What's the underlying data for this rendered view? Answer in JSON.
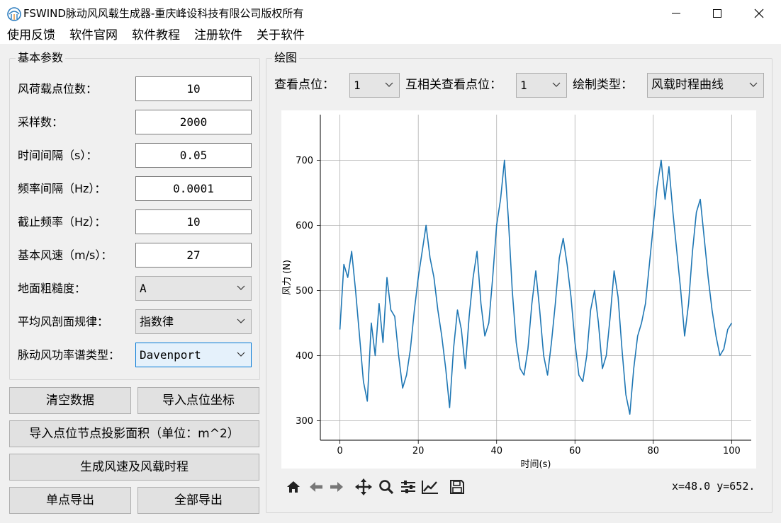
{
  "window": {
    "title": "FSWIND脉动风风载生成器-重庆峰设科技有限公司版权所有",
    "minimize_glyph": "—",
    "maximize_glyph": "☐",
    "close_glyph": "✕"
  },
  "menu": {
    "items": [
      "使用反馈",
      "软件官网",
      "软件教程",
      "注册软件",
      "关于软件"
    ]
  },
  "params": {
    "group_title": "基本参数",
    "fields": [
      {
        "label": "风荷载点位数：",
        "value": "10"
      },
      {
        "label": "采样数：",
        "value": "2000"
      },
      {
        "label": "时间间隔（s）：",
        "value": "0.05"
      },
      {
        "label": "频率间隔（Hz）：",
        "value": "0.0001"
      },
      {
        "label": "截止频率（Hz）：",
        "value": "10"
      },
      {
        "label": "基本风速（m/s）：",
        "value": "27"
      }
    ],
    "combos": [
      {
        "label": "地面粗糙度：",
        "value": "A"
      },
      {
        "label": "平均风剖面规律：",
        "value": "指数律"
      },
      {
        "label": "脉动风功率谱类型：",
        "value": "Davenport"
      }
    ]
  },
  "buttons": {
    "clear": "清空数据",
    "import_coords": "导入点位坐标",
    "import_area": "导入点位节点投影面积（单位：m^2）",
    "generate": "生成风速及风载时程",
    "export_single": "单点导出",
    "export_all": "全部导出"
  },
  "plot": {
    "group_title": "绘图",
    "view_point_label": "查看点位：",
    "view_point_value": "1",
    "cross_point_label": "互相关查看点位：",
    "cross_point_value": "1",
    "plot_type_label": "绘制类型：",
    "plot_type_value": "风载时程曲线",
    "coord_readout": "x=48.0 y=652."
  },
  "toolbar": {
    "icons": [
      "home-icon",
      "back-arrow-icon",
      "forward-arrow-icon",
      "pan-icon",
      "zoom-icon",
      "configure-subplots-icon",
      "edit-curve-icon",
      "save-icon"
    ]
  },
  "colors": {
    "line": "#1f77b4",
    "grid": "#b0b0b0",
    "focus_border": "#0078d7"
  },
  "chart_data": {
    "type": "line",
    "xlabel": "时间(s)",
    "ylabel": "风力 (N)",
    "xlim": [
      -5,
      105
    ],
    "ylim": [
      270,
      770
    ],
    "xticks": [
      0,
      20,
      40,
      60,
      80,
      100
    ],
    "yticks": [
      300,
      400,
      500,
      600,
      700
    ],
    "grid": true,
    "series": [
      {
        "x": [
          0,
          1,
          2,
          3,
          4,
          5,
          6,
          7,
          8,
          9,
          10,
          11,
          12,
          13,
          14,
          15,
          16,
          17,
          18,
          19,
          20,
          21,
          22,
          23,
          24,
          25,
          26,
          27,
          28,
          29,
          30,
          31,
          32,
          33,
          34,
          35,
          36,
          37,
          38,
          39,
          40,
          41,
          42,
          43,
          44,
          45,
          46,
          47,
          48,
          49,
          50,
          51,
          52,
          53,
          54,
          55,
          56,
          57,
          58,
          59,
          60,
          61,
          62,
          63,
          64,
          65,
          66,
          67,
          68,
          69,
          70,
          71,
          72,
          73,
          74,
          75,
          76,
          77,
          78,
          79,
          80,
          81,
          82,
          83,
          84,
          85,
          86,
          87,
          88,
          89,
          90,
          91,
          92,
          93,
          94,
          95,
          96,
          97,
          98,
          99,
          100
        ],
        "y": [
          440,
          540,
          520,
          560,
          500,
          430,
          360,
          330,
          450,
          400,
          480,
          420,
          520,
          470,
          460,
          400,
          350,
          370,
          410,
          470,
          520,
          560,
          600,
          550,
          520,
          470,
          430,
          380,
          320,
          410,
          470,
          440,
          380,
          460,
          520,
          560,
          480,
          430,
          450,
          520,
          600,
          640,
          700,
          610,
          500,
          420,
          380,
          370,
          410,
          480,
          530,
          470,
          400,
          370,
          420,
          480,
          550,
          580,
          540,
          490,
          420,
          370,
          360,
          400,
          470,
          500,
          450,
          380,
          400,
          460,
          530,
          490,
          410,
          340,
          310,
          380,
          430,
          450,
          480,
          540,
          600,
          660,
          700,
          640,
          690,
          620,
          560,
          500,
          430,
          480,
          560,
          620,
          640,
          580,
          520,
          470,
          430,
          400,
          410,
          440,
          450
        ]
      }
    ]
  }
}
